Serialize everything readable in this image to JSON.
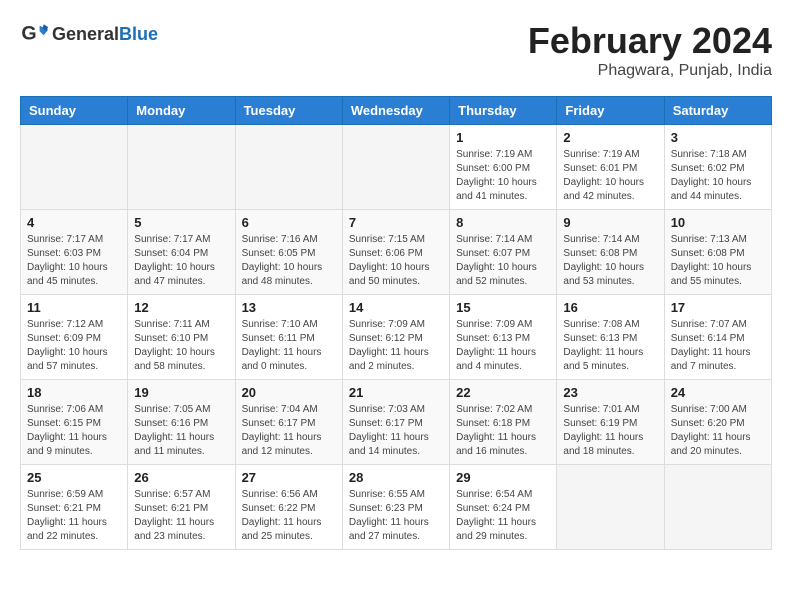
{
  "header": {
    "logo_general": "General",
    "logo_blue": "Blue",
    "month_year": "February 2024",
    "location": "Phagwara, Punjab, India"
  },
  "weekdays": [
    "Sunday",
    "Monday",
    "Tuesday",
    "Wednesday",
    "Thursday",
    "Friday",
    "Saturday"
  ],
  "weeks": [
    [
      {
        "day": "",
        "info": ""
      },
      {
        "day": "",
        "info": ""
      },
      {
        "day": "",
        "info": ""
      },
      {
        "day": "",
        "info": ""
      },
      {
        "day": "1",
        "info": "Sunrise: 7:19 AM\nSunset: 6:00 PM\nDaylight: 10 hours\nand 41 minutes."
      },
      {
        "day": "2",
        "info": "Sunrise: 7:19 AM\nSunset: 6:01 PM\nDaylight: 10 hours\nand 42 minutes."
      },
      {
        "day": "3",
        "info": "Sunrise: 7:18 AM\nSunset: 6:02 PM\nDaylight: 10 hours\nand 44 minutes."
      }
    ],
    [
      {
        "day": "4",
        "info": "Sunrise: 7:17 AM\nSunset: 6:03 PM\nDaylight: 10 hours\nand 45 minutes."
      },
      {
        "day": "5",
        "info": "Sunrise: 7:17 AM\nSunset: 6:04 PM\nDaylight: 10 hours\nand 47 minutes."
      },
      {
        "day": "6",
        "info": "Sunrise: 7:16 AM\nSunset: 6:05 PM\nDaylight: 10 hours\nand 48 minutes."
      },
      {
        "day": "7",
        "info": "Sunrise: 7:15 AM\nSunset: 6:06 PM\nDaylight: 10 hours\nand 50 minutes."
      },
      {
        "day": "8",
        "info": "Sunrise: 7:14 AM\nSunset: 6:07 PM\nDaylight: 10 hours\nand 52 minutes."
      },
      {
        "day": "9",
        "info": "Sunrise: 7:14 AM\nSunset: 6:08 PM\nDaylight: 10 hours\nand 53 minutes."
      },
      {
        "day": "10",
        "info": "Sunrise: 7:13 AM\nSunset: 6:08 PM\nDaylight: 10 hours\nand 55 minutes."
      }
    ],
    [
      {
        "day": "11",
        "info": "Sunrise: 7:12 AM\nSunset: 6:09 PM\nDaylight: 10 hours\nand 57 minutes."
      },
      {
        "day": "12",
        "info": "Sunrise: 7:11 AM\nSunset: 6:10 PM\nDaylight: 10 hours\nand 58 minutes."
      },
      {
        "day": "13",
        "info": "Sunrise: 7:10 AM\nSunset: 6:11 PM\nDaylight: 11 hours\nand 0 minutes."
      },
      {
        "day": "14",
        "info": "Sunrise: 7:09 AM\nSunset: 6:12 PM\nDaylight: 11 hours\nand 2 minutes."
      },
      {
        "day": "15",
        "info": "Sunrise: 7:09 AM\nSunset: 6:13 PM\nDaylight: 11 hours\nand 4 minutes."
      },
      {
        "day": "16",
        "info": "Sunrise: 7:08 AM\nSunset: 6:13 PM\nDaylight: 11 hours\nand 5 minutes."
      },
      {
        "day": "17",
        "info": "Sunrise: 7:07 AM\nSunset: 6:14 PM\nDaylight: 11 hours\nand 7 minutes."
      }
    ],
    [
      {
        "day": "18",
        "info": "Sunrise: 7:06 AM\nSunset: 6:15 PM\nDaylight: 11 hours\nand 9 minutes."
      },
      {
        "day": "19",
        "info": "Sunrise: 7:05 AM\nSunset: 6:16 PM\nDaylight: 11 hours\nand 11 minutes."
      },
      {
        "day": "20",
        "info": "Sunrise: 7:04 AM\nSunset: 6:17 PM\nDaylight: 11 hours\nand 12 minutes."
      },
      {
        "day": "21",
        "info": "Sunrise: 7:03 AM\nSunset: 6:17 PM\nDaylight: 11 hours\nand 14 minutes."
      },
      {
        "day": "22",
        "info": "Sunrise: 7:02 AM\nSunset: 6:18 PM\nDaylight: 11 hours\nand 16 minutes."
      },
      {
        "day": "23",
        "info": "Sunrise: 7:01 AM\nSunset: 6:19 PM\nDaylight: 11 hours\nand 18 minutes."
      },
      {
        "day": "24",
        "info": "Sunrise: 7:00 AM\nSunset: 6:20 PM\nDaylight: 11 hours\nand 20 minutes."
      }
    ],
    [
      {
        "day": "25",
        "info": "Sunrise: 6:59 AM\nSunset: 6:21 PM\nDaylight: 11 hours\nand 22 minutes."
      },
      {
        "day": "26",
        "info": "Sunrise: 6:57 AM\nSunset: 6:21 PM\nDaylight: 11 hours\nand 23 minutes."
      },
      {
        "day": "27",
        "info": "Sunrise: 6:56 AM\nSunset: 6:22 PM\nDaylight: 11 hours\nand 25 minutes."
      },
      {
        "day": "28",
        "info": "Sunrise: 6:55 AM\nSunset: 6:23 PM\nDaylight: 11 hours\nand 27 minutes."
      },
      {
        "day": "29",
        "info": "Sunrise: 6:54 AM\nSunset: 6:24 PM\nDaylight: 11 hours\nand 29 minutes."
      },
      {
        "day": "",
        "info": ""
      },
      {
        "day": "",
        "info": ""
      }
    ]
  ]
}
